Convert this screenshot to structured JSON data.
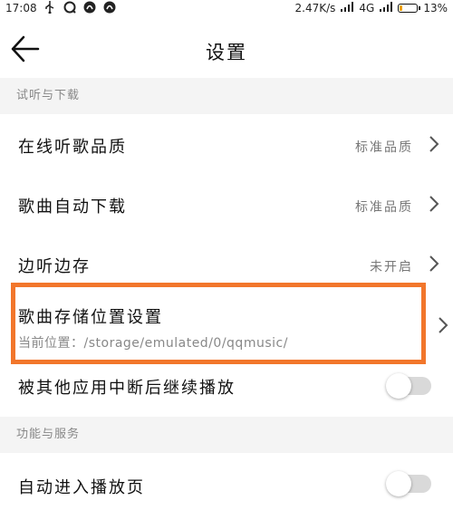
{
  "status_bar": {
    "time": "17:08",
    "network_speed": "2.47K/s",
    "network_type": "4G",
    "battery": "13%",
    "icons": [
      "usb-icon",
      "notification-icon",
      "app-icon",
      "app-icon"
    ]
  },
  "header": {
    "title": "设置"
  },
  "sections": {
    "listen_download": {
      "title": "试听与下载"
    },
    "features": {
      "title": "功能与服务"
    }
  },
  "settings": {
    "online_quality": {
      "label": "在线听歌品质",
      "value": "标准品质"
    },
    "auto_download": {
      "label": "歌曲自动下载",
      "value": "标准品质"
    },
    "listen_cache": {
      "label": "边听边存",
      "value": "未开启"
    },
    "storage_location": {
      "label": "歌曲存储位置设置",
      "sub": "当前位置：/storage/emulated/0/qqmusic/"
    },
    "continue_after_interrupt": {
      "label": "被其他应用中断后继续播放",
      "toggle": false
    },
    "auto_player_page": {
      "label": "自动进入播放页",
      "toggle": false
    }
  },
  "colors": {
    "highlight": "#f2762b",
    "section_bg": "#f4f4f4",
    "toggle_track": "#d9d9d9"
  }
}
